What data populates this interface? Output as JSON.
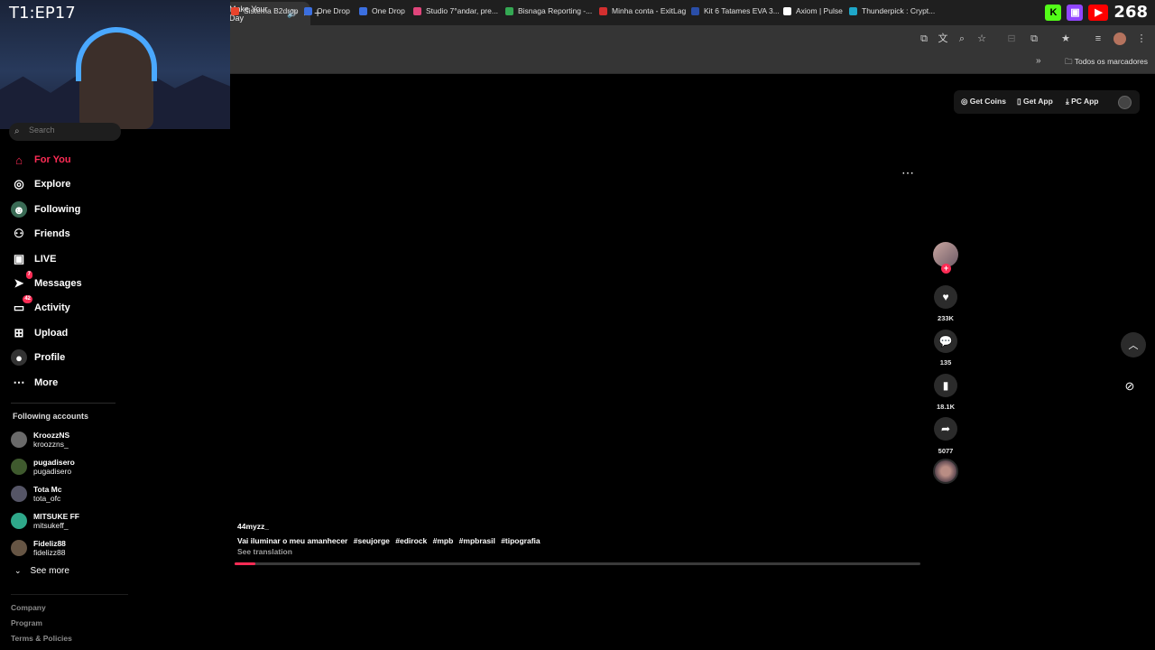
{
  "browser": {
    "tab_title": "Make Your Day",
    "bookmarks": [
      {
        "label": "Sistema B2drop",
        "color": "#e8442c"
      },
      {
        "label": "One Drop",
        "color": "#3b6fe0"
      },
      {
        "label": "One Drop",
        "color": "#3b6fe0"
      },
      {
        "label": "Studio 7°andar, pre...",
        "color": "#e0457b"
      },
      {
        "label": "Bisnaga Reporting -...",
        "color": "#34a853"
      },
      {
        "label": "Minha conta - ExitLag",
        "color": "#d32f2f"
      },
      {
        "label": "Kit 6 Tatames EVA 3...",
        "color": "#2a4ea8"
      },
      {
        "label": "Axiom | Pulse",
        "color": "#ffffff"
      },
      {
        "label": "Thunderpick : Crypt...",
        "color": "#1ea7c9"
      }
    ],
    "bookmarks_folder": "Todos os marcadores"
  },
  "overlay": {
    "episode_label": "T1:EP17",
    "viewer_count": "268",
    "kick_color": "#53fc18",
    "twitch_color": "#9146ff",
    "youtube_color": "#ff0000"
  },
  "sidebar": {
    "search_placeholder": "Search",
    "nav": [
      {
        "label": "For You",
        "icon": "home-icon",
        "active": true
      },
      {
        "label": "Explore",
        "icon": "compass-icon"
      },
      {
        "label": "Following",
        "icon": "following-icon"
      },
      {
        "label": "Friends",
        "icon": "friends-icon"
      },
      {
        "label": "LIVE",
        "icon": "live-icon"
      },
      {
        "label": "Messages",
        "icon": "messages-icon",
        "badge": "7"
      },
      {
        "label": "Activity",
        "icon": "activity-icon",
        "badge": "42"
      },
      {
        "label": "Upload",
        "icon": "upload-icon"
      },
      {
        "label": "Profile",
        "icon": "profile-icon"
      },
      {
        "label": "More",
        "icon": "more-icon"
      }
    ],
    "following_title": "Following accounts",
    "accounts": [
      {
        "name": "KroozzNS",
        "handle": "kroozzns_",
        "color": "#6a6a6a"
      },
      {
        "name": "pugadisero",
        "handle": "pugadisero",
        "color": "#3f5a2e"
      },
      {
        "name": "Tota Mc",
        "handle": "tota_ofc",
        "color": "#555566"
      },
      {
        "name": "MITSUKE FF",
        "handle": "mitsukeff_",
        "color": "#2fa88a"
      },
      {
        "name": "Fideliz88",
        "handle": "fidelizz88",
        "color": "#665544"
      }
    ],
    "see_more": "See more",
    "footer": [
      "Company",
      "Program",
      "Terms & Policies"
    ]
  },
  "header": {
    "get_coins": "Get Coins",
    "get_app": "Get App",
    "pc_app": "PC App"
  },
  "video": {
    "author": "44myzz_",
    "caption": "Vai iluminar o meu amanhecer",
    "hashtags": [
      "#seujorge",
      "#edirock",
      "#mpb",
      "#mpbrasil",
      "#tipografia"
    ],
    "see_translation": "See translation",
    "progress_percent": 3,
    "likes": "233K",
    "comments": "135",
    "saves": "18.1K",
    "shares": "5077"
  }
}
